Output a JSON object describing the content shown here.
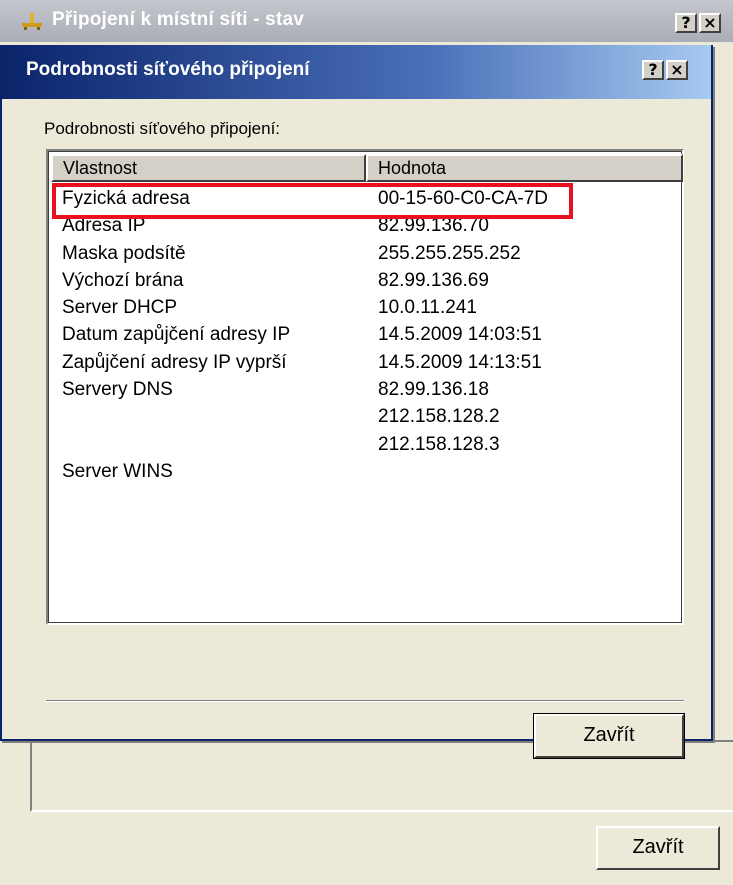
{
  "background_window": {
    "title": "Připojení k místní síti - stav",
    "help_label": "?",
    "close_label": "×",
    "close_button_label": "Zavřít"
  },
  "dialog": {
    "title": "Podrobnosti síťového připojení",
    "help_label": "?",
    "close_label": "×",
    "group_label": "Podrobnosti síťového připojení:",
    "columns": [
      "Vlastnost",
      "Hodnota"
    ],
    "rows": [
      {
        "property": "Fyzická adresa",
        "value": "00-15-60-C0-CA-7D"
      },
      {
        "property": "Adresa IP",
        "value": "82.99.136.70"
      },
      {
        "property": "Maska podsítě",
        "value": "255.255.255.252"
      },
      {
        "property": "Výchozí brána",
        "value": "82.99.136.69"
      },
      {
        "property": "Server DHCP",
        "value": "10.0.11.241"
      },
      {
        "property": "Datum zapůjčení adresy IP",
        "value": "14.5.2009 14:03:51"
      },
      {
        "property": "Zapůjčení adresy IP vyprší",
        "value": "14.5.2009 14:13:51"
      },
      {
        "property": "Servery DNS",
        "value": "82.99.136.18"
      },
      {
        "property": "",
        "value": "212.158.128.2"
      },
      {
        "property": "",
        "value": "212.158.128.3"
      },
      {
        "property": "Server WINS",
        "value": ""
      }
    ],
    "close_button_label": "Zavřít"
  },
  "colors": {
    "highlight": "#e8121e",
    "title_active": "#0a246a",
    "face": "#ece9d8"
  },
  "icons": {
    "network": "network-connection-icon"
  }
}
